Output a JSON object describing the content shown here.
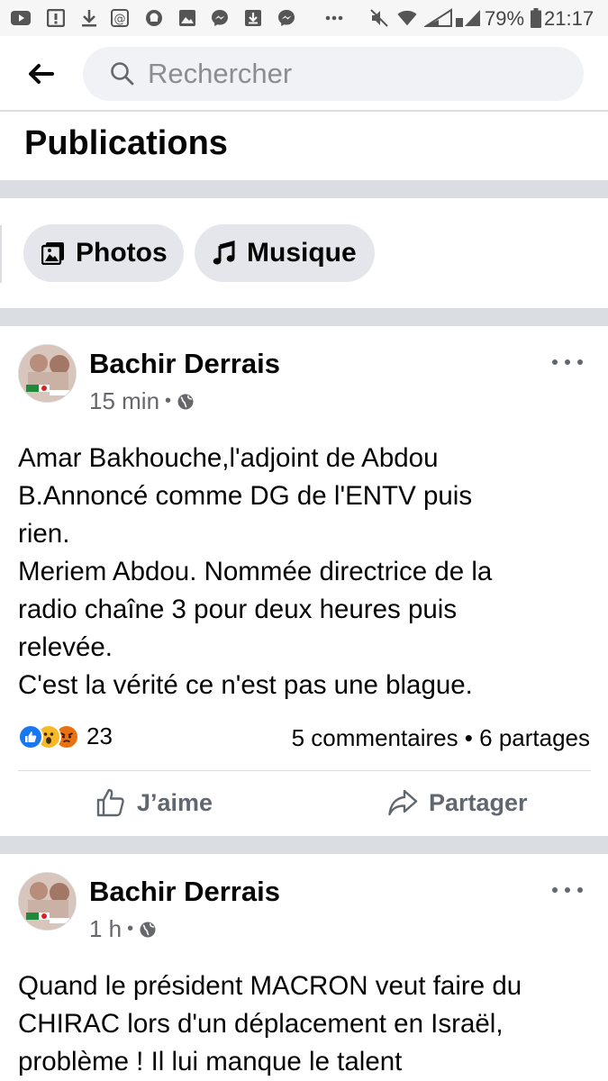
{
  "status_bar": {
    "battery_percent": "79%",
    "time": "21:17",
    "icons": [
      "youtube-icon",
      "message-icon",
      "download-icon",
      "at-icon",
      "snapchat-icon",
      "image-icon",
      "messenger-icon",
      "download-box-icon",
      "messenger-icon",
      "more-dots-icon",
      "mute-icon",
      "wifi-icon",
      "signal-icon",
      "signal-icon",
      "battery-icon"
    ]
  },
  "header": {
    "search_placeholder": "Rechercher"
  },
  "page_title": "Publications",
  "filters": [
    {
      "label": "Photos",
      "icon": "photo-icon"
    },
    {
      "label": "Musique",
      "icon": "music-note-icon"
    }
  ],
  "posts": [
    {
      "author": "Bachir Derrais",
      "time": "15 min",
      "privacy_icon": "globe-icon",
      "text_lines": [
        "Amar Bakhouche,l'adjoint de Abdou",
        "B.Annoncé comme DG de l'ENTV puis",
        "rien.",
        "Meriem Abdou. Nommée directrice de la",
        "radio chaîne 3 pour deux heures puis",
        "relevée.",
        "C'est la vérité ce n'est pas une blague."
      ],
      "reaction_icons": [
        "like-reaction-icon",
        "wow-reaction-icon",
        "angry-reaction-icon"
      ],
      "reaction_count": "23",
      "stats": "5 commentaires • 6 partages",
      "like_label": "J’aime",
      "share_label": "Partager"
    },
    {
      "author": "Bachir Derrais",
      "time": "1 h",
      "privacy_icon": "globe-icon",
      "text_lines": [
        "Quand le président MACRON veut faire du",
        "CHIRAC lors d'un déplacement en Israël,",
        "problème ! Il lui manque le talent"
      ]
    }
  ],
  "colors": {
    "separator": "#dadde1",
    "chip_bg": "#e4e6eb",
    "search_bg": "#f0f2f5",
    "like_blue": "#1877f2",
    "wow_yellow": "#f7b928",
    "angry_orange": "#e9710f"
  }
}
